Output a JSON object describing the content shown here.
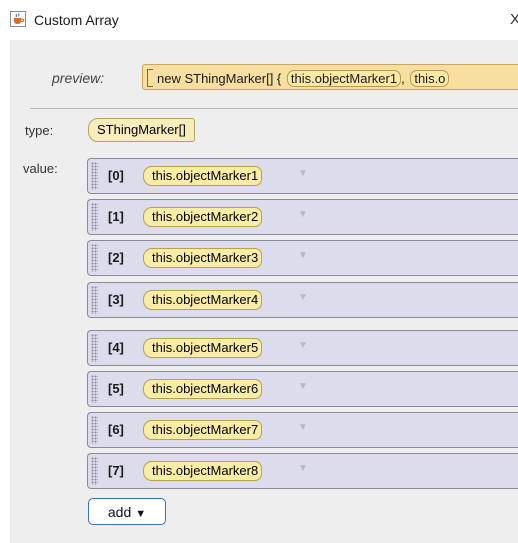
{
  "window": {
    "title": "Custom Array",
    "close_glyph": "X",
    "icon": "java-coffee-icon"
  },
  "preview": {
    "label": "preview:",
    "code_prefix": "new SThingMarker[] { ",
    "chips": [
      "this.objectMarker1",
      "this.o"
    ],
    "chip_separator": ", "
  },
  "type": {
    "label": "type:",
    "value": "SThingMarker[]"
  },
  "value": {
    "label": "value:",
    "items": [
      {
        "index": "[0]",
        "text": "this.objectMarker1"
      },
      {
        "index": "[1]",
        "text": "this.objectMarker2"
      },
      {
        "index": "[2]",
        "text": "this.objectMarker3"
      },
      {
        "index": "[3]",
        "text": "this.objectMarker4"
      },
      {
        "index": "[4]",
        "text": "this.objectMarker5"
      },
      {
        "index": "[5]",
        "text": "this.objectMarker6"
      },
      {
        "index": "[6]",
        "text": "this.objectMarker7"
      },
      {
        "index": "[7]",
        "text": "this.objectMarker8"
      }
    ],
    "item_caret": "▼"
  },
  "add_button": {
    "label": "add",
    "caret": "▼"
  },
  "colors": {
    "panel_bg": "#eeeeee",
    "chip_bg": "#f9eda6",
    "item_bg": "#dcdcec",
    "button_border": "#3b6fc4"
  }
}
